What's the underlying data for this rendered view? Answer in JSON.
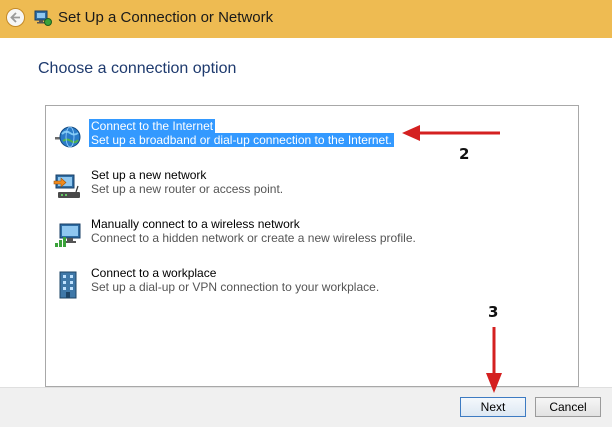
{
  "window": {
    "title": "Set Up a Connection or Network",
    "accent_color": "#eebb52"
  },
  "heading": "Choose a connection option",
  "options": [
    {
      "title": "Connect to the Internet",
      "description": "Set up a broadband or dial-up connection to the Internet.",
      "icon": "globe-network-icon",
      "selected": true
    },
    {
      "title": "Set up a new network",
      "description": "Set up a new router or access point.",
      "icon": "router-setup-icon",
      "selected": false
    },
    {
      "title": "Manually connect to a wireless network",
      "description": "Connect to a hidden network or create a new wireless profile.",
      "icon": "wireless-network-icon",
      "selected": false
    },
    {
      "title": "Connect to a workplace",
      "description": "Set up a dial-up or VPN connection to your workplace.",
      "icon": "workplace-building-icon",
      "selected": false
    }
  ],
  "buttons": {
    "next": "Next",
    "cancel": "Cancel"
  },
  "annotations": {
    "step_2": "2",
    "step_3": "3",
    "arrow_color": "#d42020"
  },
  "selection_color": "#3399ff"
}
